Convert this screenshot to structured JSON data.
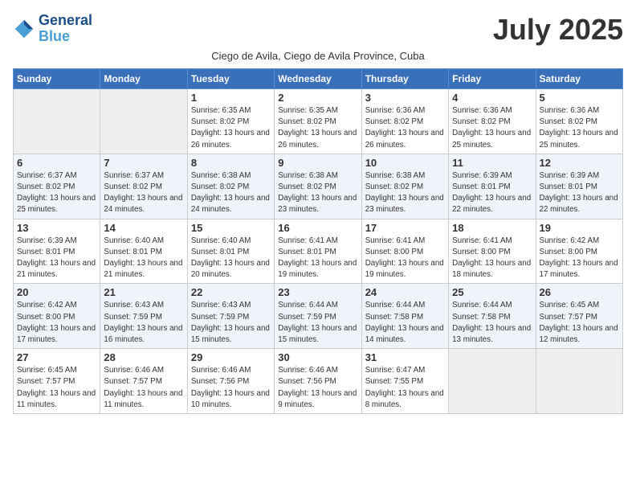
{
  "header": {
    "logo_line1": "General",
    "logo_line2": "Blue",
    "month_title": "July 2025",
    "subtitle": "Ciego de Avila, Ciego de Avila Province, Cuba"
  },
  "days_of_week": [
    "Sunday",
    "Monday",
    "Tuesday",
    "Wednesday",
    "Thursday",
    "Friday",
    "Saturday"
  ],
  "weeks": [
    [
      {
        "day": "",
        "info": ""
      },
      {
        "day": "",
        "info": ""
      },
      {
        "day": "1",
        "info": "Sunrise: 6:35 AM\nSunset: 8:02 PM\nDaylight: 13 hours\nand 26 minutes."
      },
      {
        "day": "2",
        "info": "Sunrise: 6:35 AM\nSunset: 8:02 PM\nDaylight: 13 hours\nand 26 minutes."
      },
      {
        "day": "3",
        "info": "Sunrise: 6:36 AM\nSunset: 8:02 PM\nDaylight: 13 hours\nand 26 minutes."
      },
      {
        "day": "4",
        "info": "Sunrise: 6:36 AM\nSunset: 8:02 PM\nDaylight: 13 hours\nand 25 minutes."
      },
      {
        "day": "5",
        "info": "Sunrise: 6:36 AM\nSunset: 8:02 PM\nDaylight: 13 hours\nand 25 minutes."
      }
    ],
    [
      {
        "day": "6",
        "info": "Sunrise: 6:37 AM\nSunset: 8:02 PM\nDaylight: 13 hours\nand 25 minutes."
      },
      {
        "day": "7",
        "info": "Sunrise: 6:37 AM\nSunset: 8:02 PM\nDaylight: 13 hours\nand 24 minutes."
      },
      {
        "day": "8",
        "info": "Sunrise: 6:38 AM\nSunset: 8:02 PM\nDaylight: 13 hours\nand 24 minutes."
      },
      {
        "day": "9",
        "info": "Sunrise: 6:38 AM\nSunset: 8:02 PM\nDaylight: 13 hours\nand 23 minutes."
      },
      {
        "day": "10",
        "info": "Sunrise: 6:38 AM\nSunset: 8:02 PM\nDaylight: 13 hours\nand 23 minutes."
      },
      {
        "day": "11",
        "info": "Sunrise: 6:39 AM\nSunset: 8:01 PM\nDaylight: 13 hours\nand 22 minutes."
      },
      {
        "day": "12",
        "info": "Sunrise: 6:39 AM\nSunset: 8:01 PM\nDaylight: 13 hours\nand 22 minutes."
      }
    ],
    [
      {
        "day": "13",
        "info": "Sunrise: 6:39 AM\nSunset: 8:01 PM\nDaylight: 13 hours\nand 21 minutes."
      },
      {
        "day": "14",
        "info": "Sunrise: 6:40 AM\nSunset: 8:01 PM\nDaylight: 13 hours\nand 21 minutes."
      },
      {
        "day": "15",
        "info": "Sunrise: 6:40 AM\nSunset: 8:01 PM\nDaylight: 13 hours\nand 20 minutes."
      },
      {
        "day": "16",
        "info": "Sunrise: 6:41 AM\nSunset: 8:01 PM\nDaylight: 13 hours\nand 19 minutes."
      },
      {
        "day": "17",
        "info": "Sunrise: 6:41 AM\nSunset: 8:00 PM\nDaylight: 13 hours\nand 19 minutes."
      },
      {
        "day": "18",
        "info": "Sunrise: 6:41 AM\nSunset: 8:00 PM\nDaylight: 13 hours\nand 18 minutes."
      },
      {
        "day": "19",
        "info": "Sunrise: 6:42 AM\nSunset: 8:00 PM\nDaylight: 13 hours\nand 17 minutes."
      }
    ],
    [
      {
        "day": "20",
        "info": "Sunrise: 6:42 AM\nSunset: 8:00 PM\nDaylight: 13 hours\nand 17 minutes."
      },
      {
        "day": "21",
        "info": "Sunrise: 6:43 AM\nSunset: 7:59 PM\nDaylight: 13 hours\nand 16 minutes."
      },
      {
        "day": "22",
        "info": "Sunrise: 6:43 AM\nSunset: 7:59 PM\nDaylight: 13 hours\nand 15 minutes."
      },
      {
        "day": "23",
        "info": "Sunrise: 6:44 AM\nSunset: 7:59 PM\nDaylight: 13 hours\nand 15 minutes."
      },
      {
        "day": "24",
        "info": "Sunrise: 6:44 AM\nSunset: 7:58 PM\nDaylight: 13 hours\nand 14 minutes."
      },
      {
        "day": "25",
        "info": "Sunrise: 6:44 AM\nSunset: 7:58 PM\nDaylight: 13 hours\nand 13 minutes."
      },
      {
        "day": "26",
        "info": "Sunrise: 6:45 AM\nSunset: 7:57 PM\nDaylight: 13 hours\nand 12 minutes."
      }
    ],
    [
      {
        "day": "27",
        "info": "Sunrise: 6:45 AM\nSunset: 7:57 PM\nDaylight: 13 hours\nand 11 minutes."
      },
      {
        "day": "28",
        "info": "Sunrise: 6:46 AM\nSunset: 7:57 PM\nDaylight: 13 hours\nand 11 minutes."
      },
      {
        "day": "29",
        "info": "Sunrise: 6:46 AM\nSunset: 7:56 PM\nDaylight: 13 hours\nand 10 minutes."
      },
      {
        "day": "30",
        "info": "Sunrise: 6:46 AM\nSunset: 7:56 PM\nDaylight: 13 hours\nand 9 minutes."
      },
      {
        "day": "31",
        "info": "Sunrise: 6:47 AM\nSunset: 7:55 PM\nDaylight: 13 hours\nand 8 minutes."
      },
      {
        "day": "",
        "info": ""
      },
      {
        "day": "",
        "info": ""
      }
    ]
  ]
}
